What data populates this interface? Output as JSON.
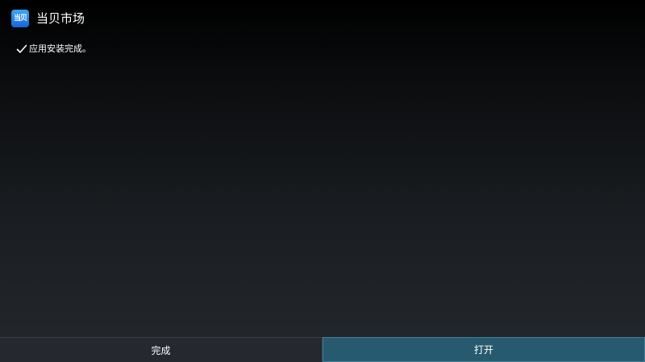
{
  "app": {
    "title": "当贝市场",
    "icon_text": "当贝",
    "icon_color": "#1f7fe8"
  },
  "install": {
    "status_text": "应用安装完成。",
    "status_icon": "checkmark-icon"
  },
  "footer": {
    "done_label": "完成",
    "open_label": "打开",
    "open_highlight_color": "#275a6e"
  }
}
